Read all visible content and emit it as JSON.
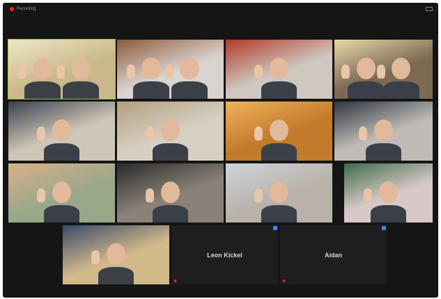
{
  "window": {
    "recording_label": "Recording"
  },
  "participants": [
    {
      "name": "",
      "bg": "#c9b98a",
      "accent": "#efe6c8"
    },
    {
      "name": "",
      "bg": "#d9d4cf",
      "accent": "#8c5a3b"
    },
    {
      "name": "",
      "bg": "#cfc8c0",
      "accent": "#b23a2a"
    },
    {
      "name": "",
      "bg": "#7c6a55",
      "accent": "#e8d8a8"
    },
    {
      "name": "",
      "bg": "#cfc6b8",
      "accent": "#3a4150"
    },
    {
      "name": "",
      "bg": "#d6cfc2",
      "accent": "#b2a07e"
    },
    {
      "name": "",
      "bg": "#c27a2c",
      "accent": "#f0b25a"
    },
    {
      "name": "",
      "bg": "#bfbcb8",
      "accent": "#2f3540"
    },
    {
      "name": "",
      "bg": "#9aa88a",
      "accent": "#d9b08a"
    },
    {
      "name": "",
      "bg": "#8a8278",
      "accent": "#2a2a2a"
    },
    {
      "name": "",
      "bg": "#b9b2aa",
      "accent": "#cfd4dc"
    },
    {
      "name": "",
      "bg": "#d8c9c8",
      "accent": "#3f6b4a"
    },
    {
      "name": "",
      "bg": "#d2b98a",
      "accent": "#3a4a6a"
    },
    {
      "name": "Leon Kickel",
      "bg": "#1e1e1e",
      "accent": "#1e1e1e"
    },
    {
      "name": "Aidan",
      "bg": "#1e1e1e",
      "accent": "#1e1e1e"
    }
  ]
}
